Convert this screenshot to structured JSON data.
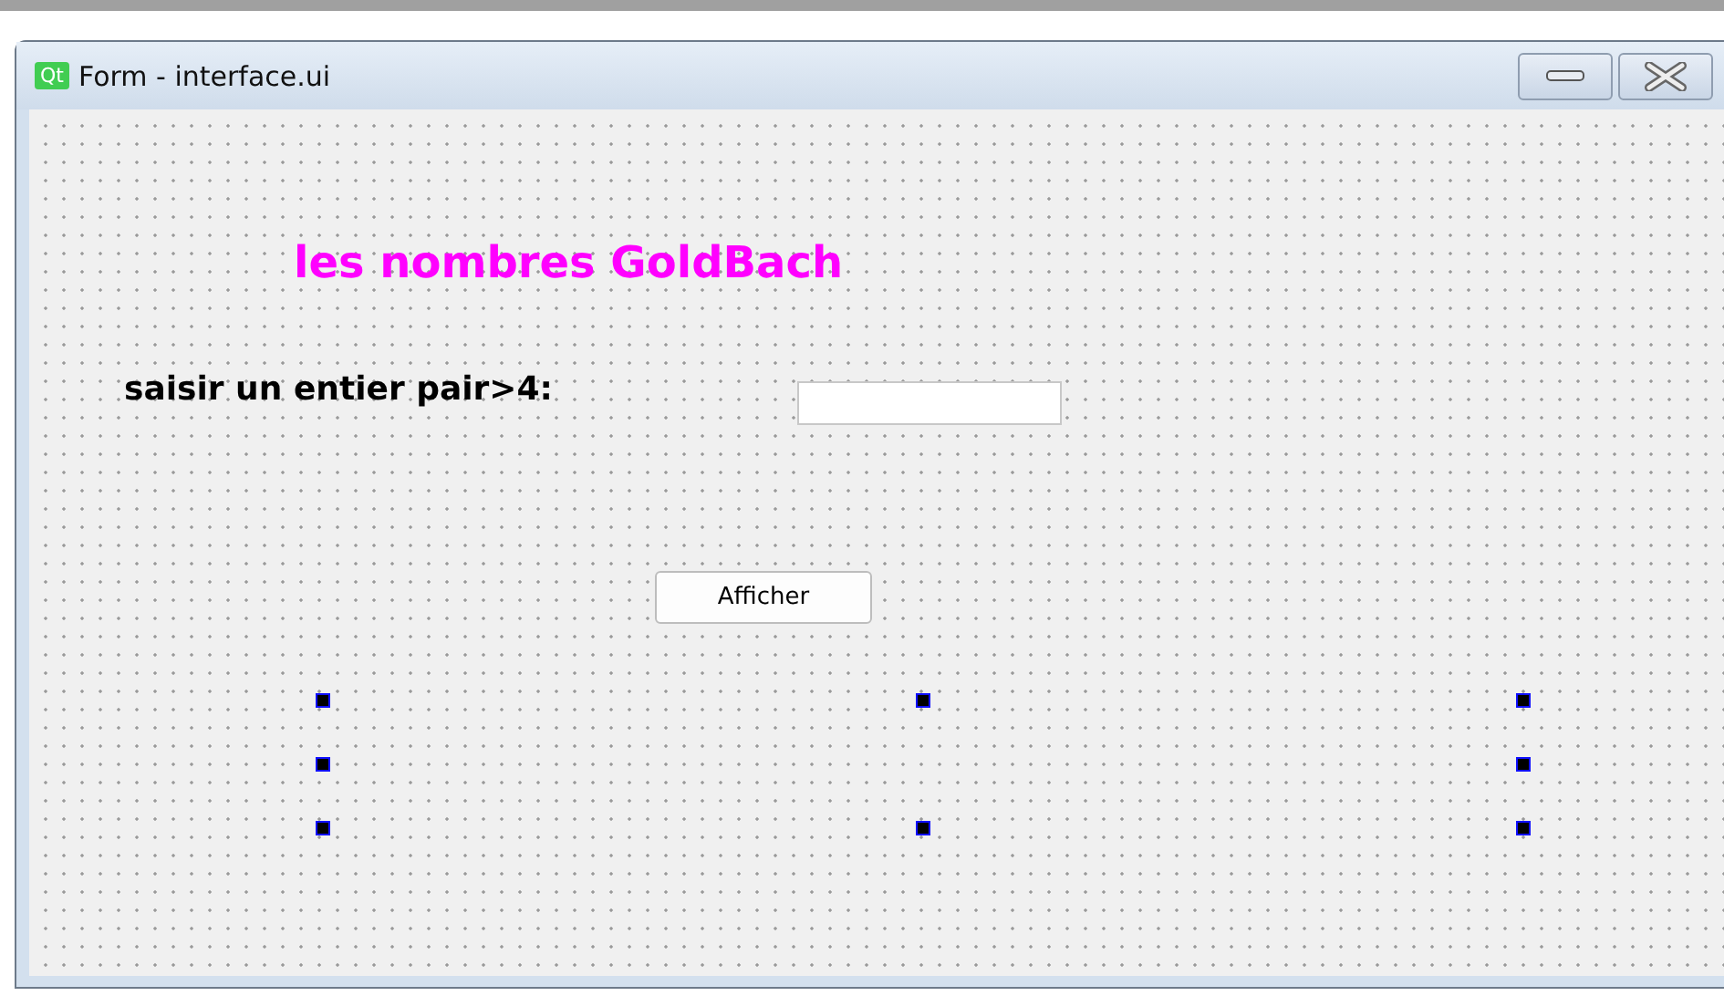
{
  "window": {
    "title": "Form - interface.ui",
    "app_badge": "Qt"
  },
  "form": {
    "heading": "les nombres GoldBach",
    "prompt": "saisir un entier pair>4:",
    "button": "Afficher",
    "empty_label": {
      "selected": true
    }
  }
}
